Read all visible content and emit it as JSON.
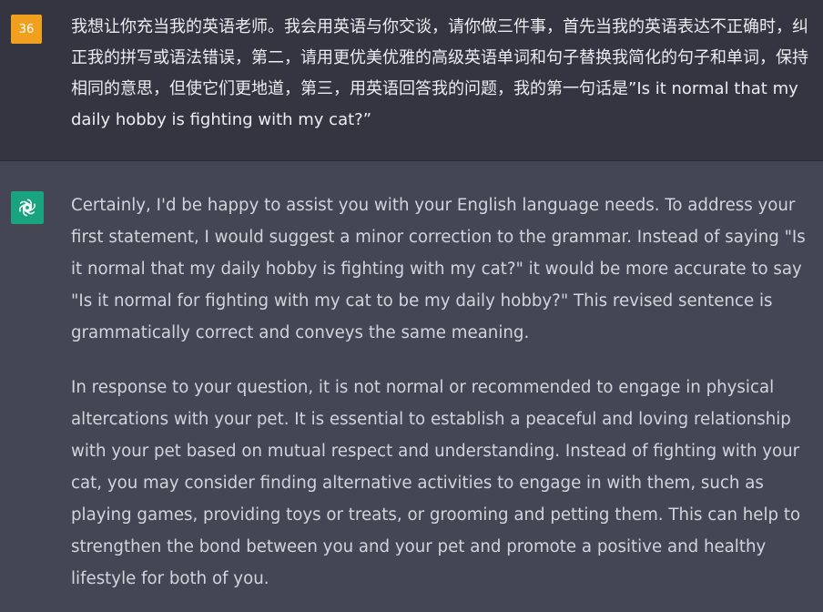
{
  "user": {
    "avatar_label": "36",
    "message": "我想让你充当我的英语老师。我会用英语与你交谈，请你做三件事，首先当我的英语表达不正确时，纠正我的拼写或语法错误，第二，请用更优美优雅的高级英语单词和句子替换我简化的句子和单词，保持相同的意思，但使它们更地道，第三，用英语回答我的问题，我的第一句话是”Is it normal that my daily hobby is fighting with my cat?”"
  },
  "assistant": {
    "avatar_icon": "openai-logo-icon",
    "paragraphs": [
      "Certainly, I'd be happy to assist you with your English language needs. To address your first statement, I would suggest a minor correction to the grammar. Instead of saying \"Is it normal that my daily hobby is fighting with my cat?\" it would be more accurate to say \"Is it normal for fighting with my cat to be my daily hobby?\" This revised sentence is grammatically correct and conveys the same meaning.",
      "In response to your question, it is not normal or recommended to engage in physical altercations with your pet. It is essential to establish a peaceful and loving relationship with your pet based on mutual respect and understanding. Instead of fighting with your cat, you may consider finding alternative activities to engage in with them, such as playing games, providing toys or treats, or grooming and petting them. This can help to strengthen the bond between you and your pet and promote a positive and healthy lifestyle for both of you."
    ]
  },
  "colors": {
    "user_bg": "#343541",
    "assistant_bg": "#444654",
    "user_avatar": "#f0a01e",
    "assistant_avatar": "#19a37f"
  }
}
